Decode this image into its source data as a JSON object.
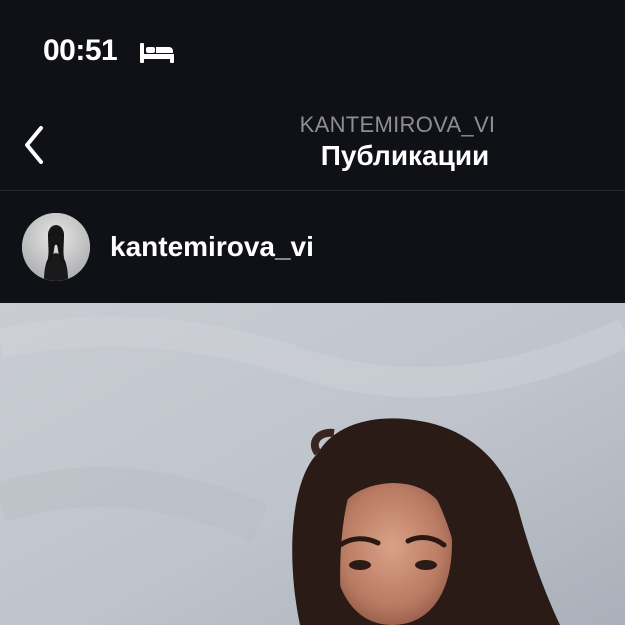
{
  "status_bar": {
    "time": "00:51",
    "sleep_icon": "bed-icon"
  },
  "nav": {
    "back_icon": "chevron-left-icon",
    "account": "KANTEMIROVA_VI",
    "title": "Публикации"
  },
  "post": {
    "username": "kantemirova_vi",
    "avatar_icon": "avatar",
    "image": "photo-post"
  },
  "colors": {
    "background": "#0f1117",
    "subtitle": "#8e8e93",
    "text": "#ffffff"
  }
}
